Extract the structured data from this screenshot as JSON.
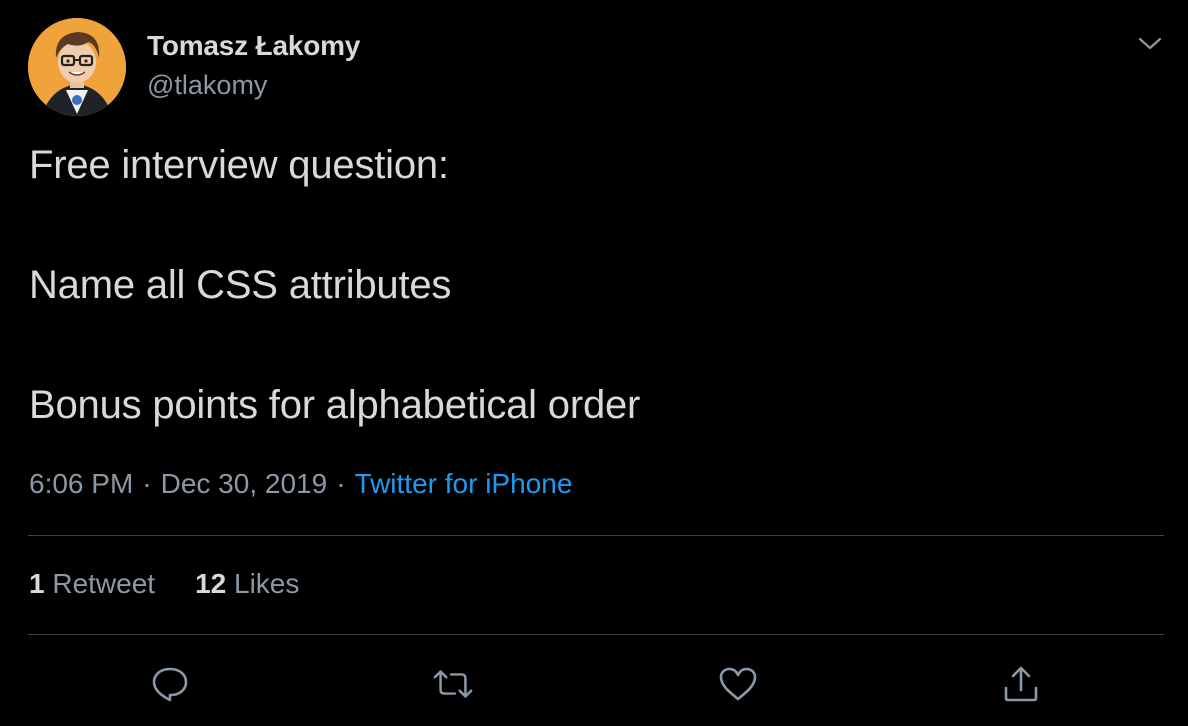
{
  "author": {
    "display_name": "Tomasz Łakomy",
    "handle": "@tlakomy"
  },
  "tweet": {
    "lines": [
      "Free interview question:",
      "Name all CSS attributes",
      "Bonus points for alphabetical order"
    ],
    "time": "6:06 PM",
    "date": "Dec 30, 2019",
    "separator": "·",
    "source": "Twitter for iPhone"
  },
  "stats": {
    "retweets_count": "1",
    "retweets_label": "Retweet",
    "likes_count": "12",
    "likes_label": "Likes"
  },
  "icons": {
    "caret": "chevron-down-icon",
    "reply": "reply-icon",
    "retweet": "retweet-icon",
    "like": "heart-icon",
    "share": "share-icon"
  },
  "colors": {
    "background": "#000000",
    "text_primary": "#d9d9d9",
    "text_secondary": "#8b98a5",
    "link": "#1d9bf0",
    "divider": "#38444d",
    "avatar_bg": "#f0a33a"
  }
}
